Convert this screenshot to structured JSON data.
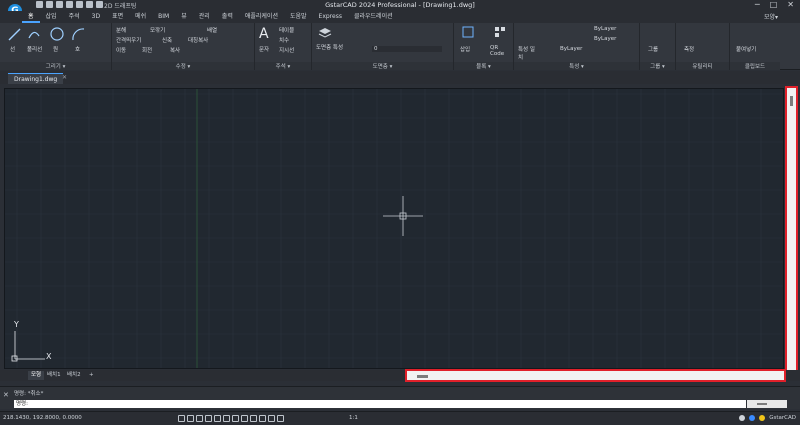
{
  "app": {
    "logo_letter": "G",
    "title": "GstarCAD 2024 Professional - [Drawing1.dwg]",
    "workspace": "2D 드래프팅"
  },
  "window_controls": [
    "─",
    "□",
    "✕"
  ],
  "menu": {
    "tabs": [
      "홈",
      "삽입",
      "주석",
      "3D",
      "표면",
      "메쉬",
      "BIM",
      "뷰",
      "관리",
      "출력",
      "애플리케이션",
      "도움말",
      "Express",
      "클라우드레이션"
    ],
    "active": "홈",
    "right_label": "모양▾"
  },
  "ribbon": {
    "groups": {
      "draw": {
        "label": "그리기 ▾",
        "items": [
          "선",
          "폴리선",
          "원",
          "호"
        ]
      },
      "modify": {
        "label": "수정 ▾",
        "items": [
          "이동",
          "회전",
          "복사",
          "신축",
          "대칭복사",
          "간격띄우기",
          "모깎기",
          "분해",
          "배열"
        ]
      },
      "annotation": {
        "label": "주석 ▾",
        "items": [
          "문자",
          "테이블",
          "치수",
          "지시선"
        ]
      },
      "layers": {
        "label": "도면층 ▾",
        "items": [
          "도면층 특성",
          "0"
        ]
      },
      "block": {
        "label": "블록 ▾",
        "items": [
          "삽입",
          "QR Code"
        ]
      },
      "properties": {
        "label": "특성 ▾",
        "items": [
          "특성 일치",
          "ByLayer",
          "ByLayer",
          "ByLayer"
        ]
      },
      "group": {
        "label": "그룹 ▾",
        "items": [
          "그룹"
        ]
      },
      "utilities": {
        "label": "유틸리티",
        "items": [
          "측정"
        ]
      },
      "clipboard": {
        "label": "클립보드",
        "items": [
          "붙여넣기"
        ]
      }
    }
  },
  "doc_tab": {
    "label": "Drawing1.dwg",
    "close": "✕"
  },
  "ucs": {
    "x_label": "X",
    "y_label": "Y"
  },
  "layout_tabs": [
    "모형",
    "배치1",
    "배치2",
    "+"
  ],
  "command": {
    "history": [
      "명령: *취소*",
      "명령:"
    ],
    "input": ""
  },
  "status": {
    "coordinates": "218.1430, 192.8000, 0.0000",
    "scale": "1:1",
    "right_label": "GstarCAD"
  },
  "colors": {
    "canvas": "#212830",
    "grid": "#2a333d",
    "accent": "#4aa3ff",
    "highlight": "#e0202a"
  }
}
